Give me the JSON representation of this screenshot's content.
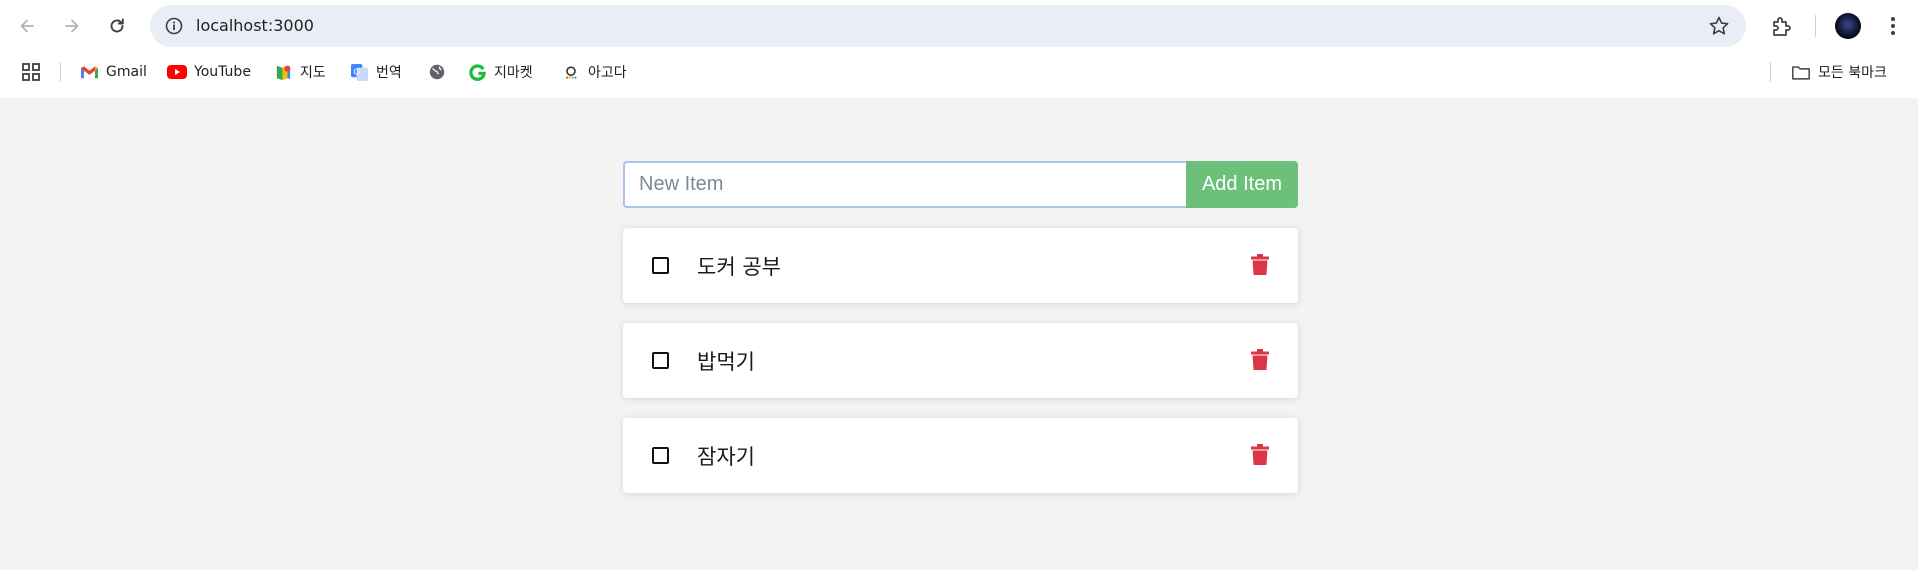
{
  "browser": {
    "url": "localhost:3000",
    "bookmarks": [
      {
        "label": "Gmail",
        "icon": "gmail-icon"
      },
      {
        "label": "YouTube",
        "icon": "youtube-icon"
      },
      {
        "label": "지도",
        "icon": "maps-icon"
      },
      {
        "label": "번역",
        "icon": "translate-icon"
      },
      {
        "label": "",
        "icon": "globe-icon"
      },
      {
        "label": "지마켓",
        "icon": "gmarket-icon"
      },
      {
        "label": "아고다",
        "icon": "agoda-icon"
      }
    ],
    "all_bookmarks_label": "모든 북마크"
  },
  "app": {
    "new_item_placeholder": "New Item",
    "add_button_label": "Add Item",
    "accent_color": "#6cc07a",
    "delete_color": "#dc3545",
    "todos": [
      {
        "text": "도커 공부",
        "done": false
      },
      {
        "text": "밥먹기",
        "done": false
      },
      {
        "text": "잠자기",
        "done": false
      }
    ]
  }
}
